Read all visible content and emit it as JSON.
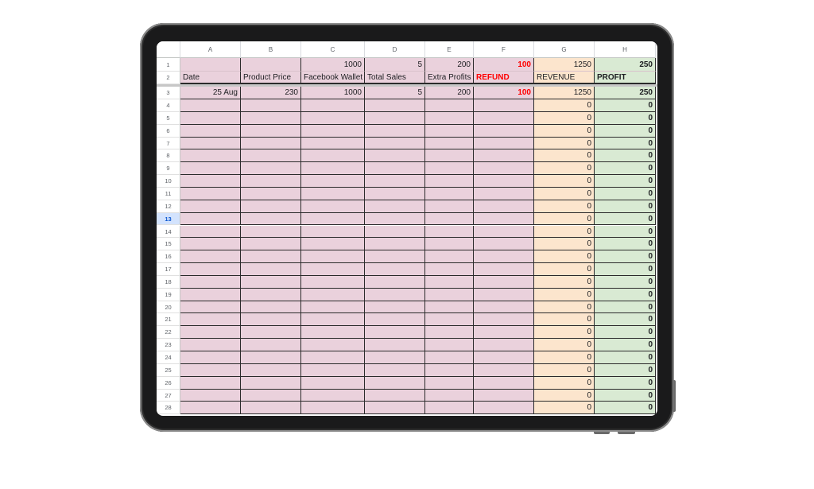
{
  "columns": [
    "A",
    "B",
    "C",
    "D",
    "E",
    "F",
    "G",
    "H"
  ],
  "row1": [
    "",
    "",
    "1000",
    "5",
    "200",
    "100",
    "1250",
    "250"
  ],
  "headers": [
    "Date",
    "Product Price",
    "Facebook Wallet",
    "Total Sales",
    "Extra Profits",
    "REFUND",
    "REVENUE",
    "PROFIT"
  ],
  "row3": [
    "25 Aug",
    "230",
    "1000",
    "5",
    "200",
    "100",
    "1250",
    "250"
  ],
  "empty_rows": {
    "start": 4,
    "end": 28,
    "revenue_value": "0",
    "profit_value": "0"
  },
  "selected_row": 13,
  "colors": {
    "pink_fill": "#ead1dc",
    "revenue_fill": "#fce5cd",
    "profit_fill": "#d9ead3",
    "refund_text": "#ff0000"
  }
}
